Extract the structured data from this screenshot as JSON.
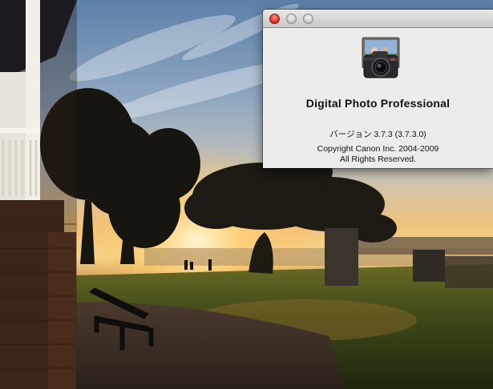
{
  "about_window": {
    "app_name": "Digital Photo Professional",
    "version": "バージョン 3.7.3 (3.7.3.0)",
    "copyright": "Copyright Canon Inc. 2004-2009",
    "rights": "All Rights Reserved.",
    "icon": "camera-photo-icon"
  },
  "titlebar": {
    "buttons": [
      "close",
      "minimize",
      "zoom"
    ]
  },
  "colors": {
    "close_button": "#e8382a",
    "window_bg": "#ececec"
  }
}
